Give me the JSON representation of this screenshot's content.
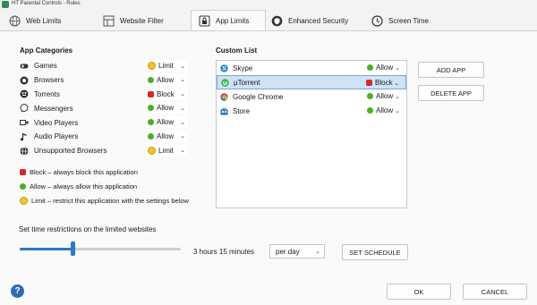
{
  "window": {
    "title": "HT Parental Controls - Rules"
  },
  "tabs": [
    {
      "label": "Web Limits",
      "icon": "globe-icon"
    },
    {
      "label": "Website Filter",
      "icon": "filter-grid-icon"
    },
    {
      "label": "App Limits",
      "icon": "lock-icon",
      "active": true
    },
    {
      "label": "Enhanced Security",
      "icon": "shield-icon"
    },
    {
      "label": "Screen Time",
      "icon": "clock-icon"
    }
  ],
  "categories": {
    "heading": "App Categories",
    "items": [
      {
        "label": "Games",
        "icon": "gamepad-icon",
        "status": "Limit",
        "color": "yellow"
      },
      {
        "label": "Browsers",
        "icon": "browser-icon",
        "status": "Allow",
        "color": "green"
      },
      {
        "label": "Torrents",
        "icon": "torrent-icon",
        "status": "Block",
        "color": "red"
      },
      {
        "label": "Messengers",
        "icon": "chat-icon",
        "status": "Allow",
        "color": "green"
      },
      {
        "label": "Video Players",
        "icon": "video-icon",
        "status": "Allow",
        "color": "green"
      },
      {
        "label": "Audio Players",
        "icon": "music-icon",
        "status": "Allow",
        "color": "green"
      },
      {
        "label": "Unsupported Browsers",
        "icon": "globe-icon",
        "status": "Limit",
        "color": "yellow"
      }
    ]
  },
  "legend": {
    "block": "Block – always block this application",
    "allow": "Allow – always allow this application",
    "limit": "Limit – restrict this application with the settings below"
  },
  "custom": {
    "heading": "Custom List",
    "items": [
      {
        "label": "Skype",
        "icon": "skype-icon",
        "status": "Allow",
        "color": "green"
      },
      {
        "label": "µTorrent",
        "icon": "utorrent-icon",
        "status": "Block",
        "color": "red",
        "selected": true
      },
      {
        "label": "Google Chrome",
        "icon": "chrome-icon",
        "status": "Allow",
        "color": "green"
      },
      {
        "label": "Store",
        "icon": "store-icon",
        "status": "Allow",
        "color": "green"
      }
    ]
  },
  "buttons": {
    "add_app": "ADD APP",
    "delete_app": "DELETE APP",
    "set_schedule": "SET SCHEDULE",
    "ok": "OK",
    "cancel": "CANCEL"
  },
  "time": {
    "label": "Set time restrictions on the limited websites",
    "value_text": "3 hours 15 minutes",
    "slider_fraction": 0.33,
    "period": "per day"
  },
  "help": {
    "glyph": "?"
  },
  "colors": {
    "accent": "#2a78c8",
    "allow": "#4caf20",
    "block": "#d62828",
    "limit": "#f2c230",
    "selected_row": "#cfe2f6"
  }
}
